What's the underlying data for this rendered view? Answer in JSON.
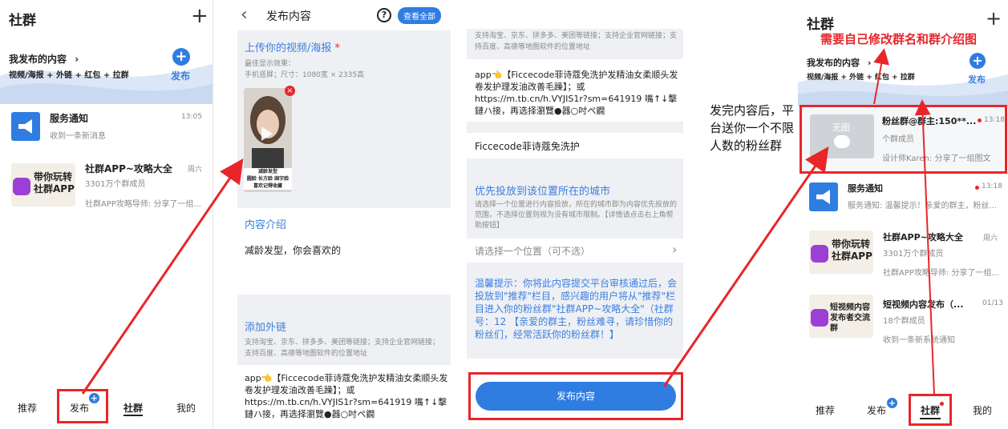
{
  "colors": {
    "accent": "#2f7de1",
    "annotation_red": "#e8262a",
    "wave": "#dbe6f6"
  },
  "panel1": {
    "title": "社群",
    "my_content": "我发布的内容",
    "my_content_sub": "视频/海报 + 外链 + 红包 + 拉群",
    "publish": "发布",
    "items": [
      {
        "name": "服务通知",
        "time": "13:05",
        "desc": "收到一条新消息"
      },
      {
        "name": "社群APP~攻略大全",
        "time": "周六",
        "members": "3301万个群成员",
        "desc": "社群APP攻略导师: 分享了一组..."
      }
    ],
    "thumb_text": "带你玩转社群APP",
    "nav": [
      "推荐",
      "发布",
      "社群",
      "我的"
    ]
  },
  "panel2": {
    "header": "发布内容",
    "help": "?",
    "view_all": "查看全部",
    "upload_title": "上传你的视频/海报",
    "required": "*",
    "best_effect": "最佳显示效果：",
    "phone_size": "手机竖屏；尺寸：1080宽 × 2335高",
    "poster_caption": [
      "减龄发型",
      "圆脸 长方脸 国字脸",
      "喜欢记得收藏"
    ],
    "intro_title": "内容介绍",
    "intro_text": "减龄发型，你会喜欢的",
    "link_title": "添加外链",
    "link_desc": "支持淘宝、京东、拼多多、美团等链接；支持企业官网链接；支持百度、高德等地图软件的位置地址",
    "link_value": "app👈【Ficcecode菲诗蔻免洗护发精油女柔顺头发卷发护理发油改善毛躁】；或https://m.tb.cn/h.VYJIS1r?sm=641919 嘴↑↓擊鏈ハ接，再选择瀏覽●器○吋ペ鐗"
  },
  "panel3": {
    "link_desc": "支持淘宝、京东、拼多多、美团等链接；支持企业官网链接；支持百度、高德等地图软件的位置地址",
    "link_value": "app👈【Ficcecode菲诗蔻免洗护发精油女柔顺头发卷发护理发油改善毛躁】；或https://m.tb.cn/h.VYJIS1r?sm=641919 嘴↑↓擊鏈ハ接，再选择瀏覽●器○吋ペ鐗",
    "shop_name": "Ficcecode菲诗蔻免洗护",
    "city_title": "优先投放到该位置所在的城市",
    "city_desc": "请选择一个位置进行内容投放，所在的城市即为内容优先投放的范围，不选择位置则视为没有城市限制。【详情请点击右上角帮助按钮】",
    "location_placeholder": "请选择一个位置（可不选）",
    "tip": "温馨提示：你将此内容提交平台审核通过后，会投放到\"推荐\"栏目，感兴趣的用户将从\"推荐\"栏目进入你的粉丝群\"社群APP~攻略大全\"（社群号：12        【亲爱的群主，粉丝难寻，请珍惜你的粉丝们，经常活跃你的粉丝群！】",
    "publish_button": "发布内容"
  },
  "annotations": {
    "fans_group": "发完内容后，平台送你一个不限人数的粉丝群",
    "edit_hint": "需要自己修改群名和群介绍图"
  },
  "panel4": {
    "title": "社群",
    "my_content": "我发布的内容",
    "my_content_sub": "视频/海报 + 外链 + 红包 + 拉群",
    "publish": "发布",
    "items": [
      {
        "name": "粉丝群@群主:150**...",
        "time": "13:18",
        "members": "个群成员",
        "desc": "设计师Karen: 分享了一组图文",
        "thumb": "无图"
      },
      {
        "name": "服务通知",
        "time": "13:18",
        "desc": "服务通知: 温馨提示！亲爱的群主，粉丝..."
      },
      {
        "name": "社群APP~攻略大全",
        "time": "周六",
        "members": "3301万个群成员",
        "desc": "社群APP攻略导师: 分享了一组..."
      },
      {
        "name": "短视频内容发布（...",
        "time": "01/13",
        "members": "18个群成员",
        "desc": "收到一条新系统通知"
      }
    ],
    "thumb_text1": "带你玩转社群APP",
    "thumb_text2": "短视频内容发布者交流群",
    "nav": [
      "推荐",
      "发布",
      "社群",
      "我的"
    ]
  }
}
